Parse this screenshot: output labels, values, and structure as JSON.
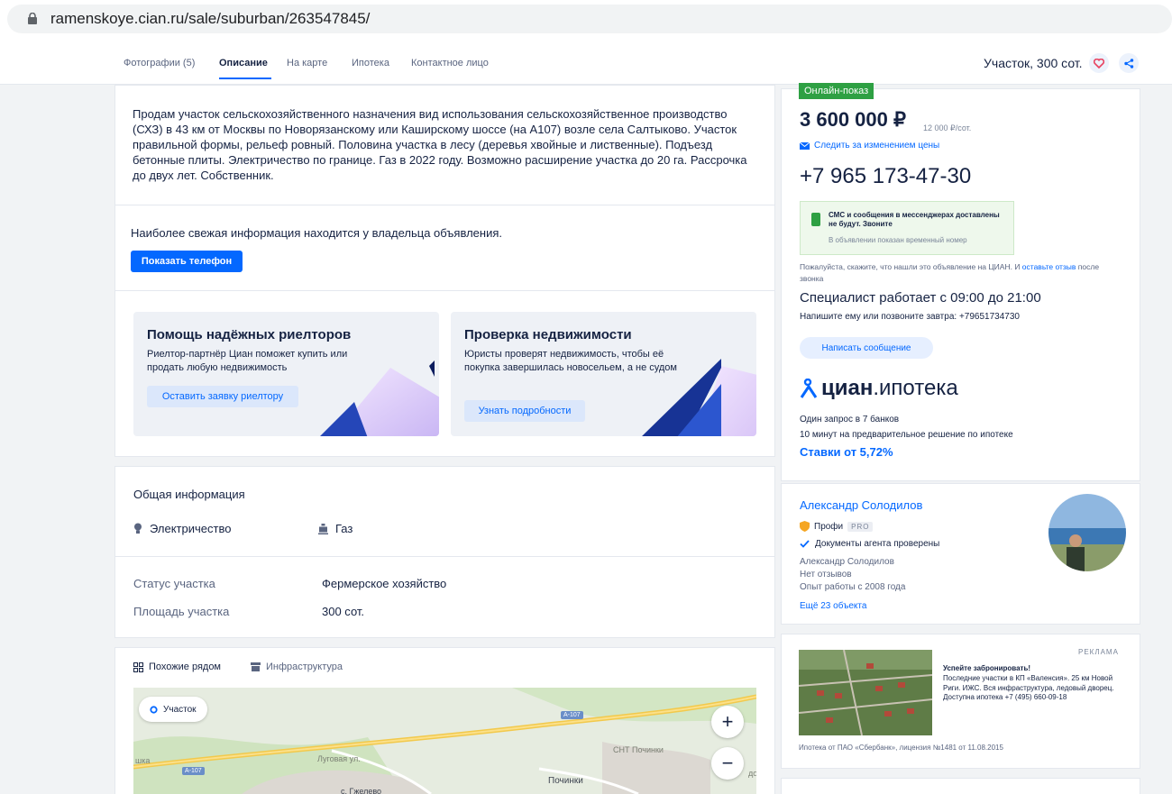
{
  "browser": {
    "url": "ramenskoye.cian.ru/sale/suburban/263547845/"
  },
  "nav": {
    "tabs": [
      {
        "label": "Фотографии (5)"
      },
      {
        "label": "Описание"
      },
      {
        "label": "На карте"
      },
      {
        "label": "Ипотека"
      },
      {
        "label": "Контактное лицо"
      }
    ],
    "summary": "Участок, 300 сот."
  },
  "description": {
    "text": "Продам участок сельскохозяйственного назначения вид использования сельскохозяйственное производство (СХЗ) в 43 км от Москвы по Новорязанскому или Каширскому шоссе (на А107) возле села Салтыково. Участок правильной формы, рельеф ровный. Половина участка в лесу (деревья хвойные и лиственные). Подъезд бетонные плиты. Электричество по границе. Газ в 2022 году. Возможно расширение участка до 20 га. Рассрочка до двух лет. Собственник."
  },
  "contact": {
    "fresh_info": "Наиболее свежая информация находится у владельца объявления.",
    "show_phone": "Показать телефон"
  },
  "promos": [
    {
      "title": "Помощь надёжных риелторов",
      "text": "Риелтор-партнёр Циан поможет купить или продать любую недвижимость",
      "button": "Оставить заявку риелтору"
    },
    {
      "title": "Проверка недвижимости",
      "text": "Юристы проверят недвижимость, чтобы её покупка завершилась новосельем, а не судом",
      "button": "Узнать подробности"
    }
  ],
  "general": {
    "title": "Общая информация",
    "features": [
      "Электричество",
      "Газ"
    ],
    "rows": [
      {
        "label": "Статус участка",
        "value": "Фермерское хозяйство"
      },
      {
        "label": "Площадь участка",
        "value": "300 сот."
      }
    ]
  },
  "map_section": {
    "tabs": [
      "Похожие рядом",
      "Инфраструктура"
    ],
    "chip": "Участок",
    "labels": {
      "road1": "А-107",
      "road2": "А-107",
      "street": "Луговая ул.",
      "snt": "СНТ Починки",
      "village": "Починки",
      "left": "шка",
      "right": "дом",
      "bottom": "с. Гжелево"
    },
    "zoom_in": "+",
    "zoom_out": "−"
  },
  "price_card": {
    "badge": "Онлайн-показ",
    "price": "3 600 000 ₽",
    "price_per": "12 000 ₽/сот.",
    "follow": "Следить за изменением цены",
    "phone": "+7 965 173-47-30",
    "sms_title": "СМС и сообщения в мессенджерах доставлены не будут. Звоните",
    "sms_sub": "В объявлении показан временный номер",
    "please_pre": "Пожалуйста, скажите, что нашли это объявление на ЦИАН. И ",
    "please_link": "оставьте отзыв",
    "please_post": " после звонка",
    "hours": "Специалист работает с 09:00 до 21:00",
    "write_tomorrow": "Напишите ему или позвоните завтра: +79651734730",
    "message_btn": "Написать сообщение",
    "logo_bold": "циан",
    "logo_rest": ".ипотека",
    "bank_line1": "Один запрос в 7 банков",
    "bank_line2": "10 минут на предварительное решение по ипотеке",
    "rates": "Ставки от 5,72%"
  },
  "agent": {
    "name": "Александр Солодилов",
    "profi": "Профи",
    "pro": "PRO",
    "docs_checked": "Документы агента проверены",
    "meta_name": "Александр Солодилов",
    "reviews": "Нет отзывов",
    "experience": "Опыт работы с 2008 года",
    "more": "Ещё 23 объекта"
  },
  "ad": {
    "label": "РЕКЛАМА",
    "title": "Успейте забронировать!",
    "text": "Последние участки в КП «Валенсия». 25 км Новой Риги. ИЖС. Вся инфраструктура, ледовый дворец. Доступна ипотека +7 (495) 660-09-18",
    "footer": "Ипотека от ПАО «Сбербанк», лицензия №1481 от 11.08.2015"
  }
}
